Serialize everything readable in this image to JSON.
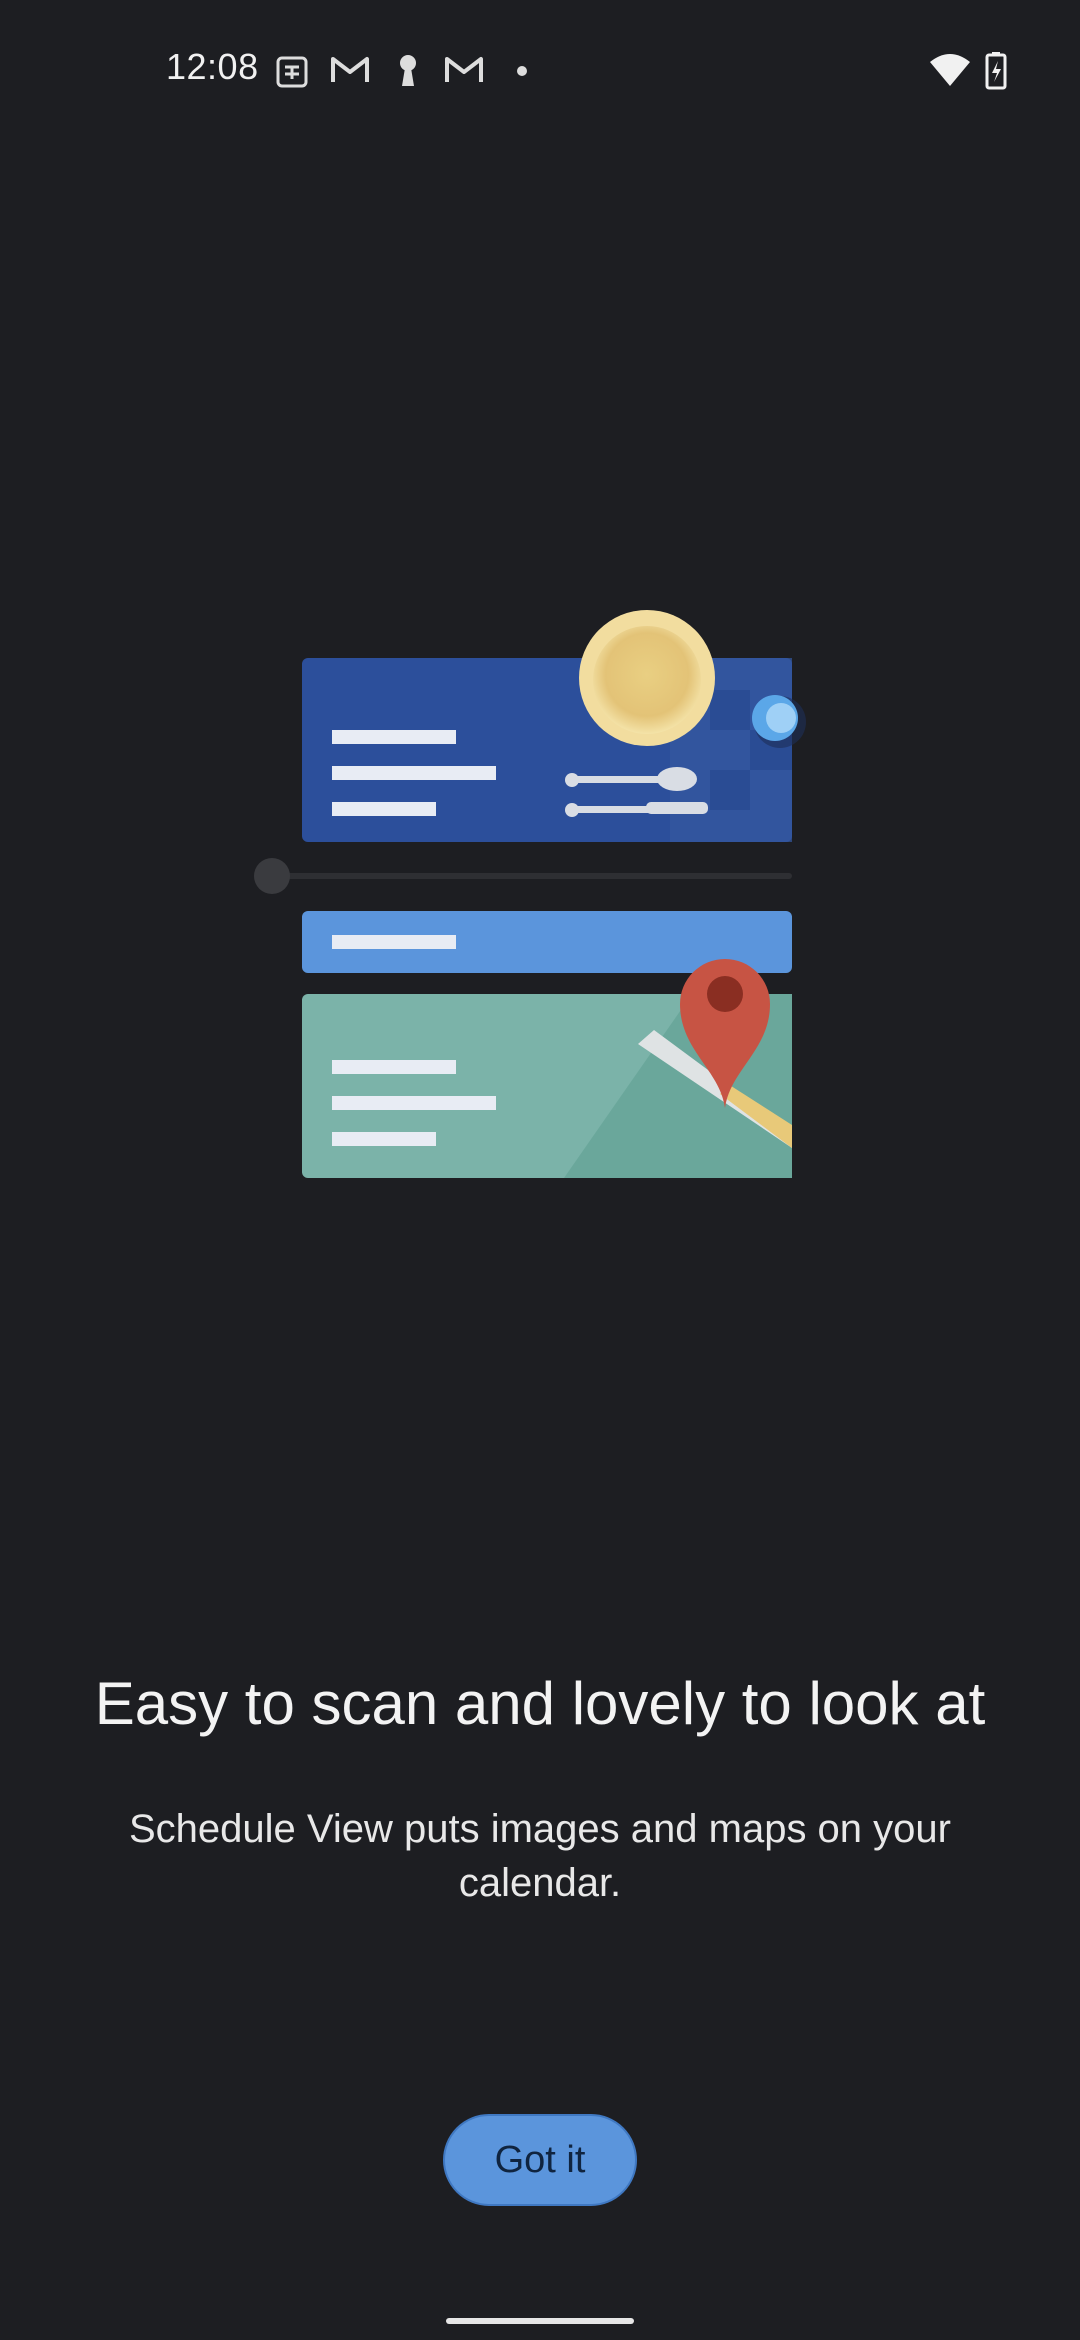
{
  "status_bar": {
    "time": "12:08",
    "icons": [
      "calendar-notification-icon",
      "gmail-icon",
      "keyhole-icon",
      "gmail-icon",
      "dot-icon",
      "wifi-icon",
      "battery-charging-icon"
    ]
  },
  "illustration": {
    "description_icons": [
      "plate-icon",
      "cup-icon",
      "spoon-icon",
      "knife-icon",
      "map-pin-icon"
    ],
    "colors": {
      "card_blue": "#2c4f9b",
      "card_light_blue": "#5b95dc",
      "card_teal": "#7bb3a9",
      "plate": "#f2dd9f",
      "pin": "#c75444"
    }
  },
  "onboarding": {
    "headline": "Easy to scan and lovely to look at",
    "description": "Schedule View puts images and maps on your calendar."
  },
  "button": {
    "label": "Got it"
  },
  "colors": {
    "background": "#1d1e22",
    "accent": "#5b95dc"
  }
}
